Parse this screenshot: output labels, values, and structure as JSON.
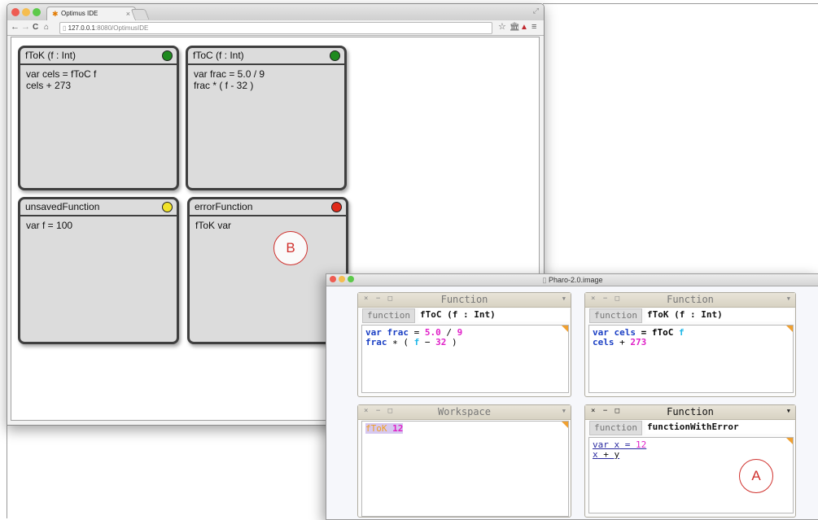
{
  "browser": {
    "tab_title": "Optimus IDE",
    "url_host": "127.0.0.1",
    "url_path": ":8080/OptimusIDE",
    "icons": {
      "back": "left-arrow",
      "forward": "right-arrow",
      "reload": "reload",
      "home": "home",
      "star": "star",
      "close": "×"
    }
  },
  "cards": [
    {
      "name": "fToK (f : Int)",
      "status": "saved",
      "status_color": "#1f8a1f",
      "lines": [
        "var cels = fToC f",
        "cels + 273"
      ]
    },
    {
      "name": "fToC (f : Int)",
      "status": "saved",
      "status_color": "#1f8a1f",
      "lines": [
        "var frac = 5.0 / 9",
        "frac * ( f - 32 )"
      ]
    },
    {
      "name": "unsavedFunction",
      "status": "unsaved",
      "status_color": "#f2e32a",
      "lines": [
        "var f = 100"
      ]
    },
    {
      "name": "errorFunction",
      "status": "error",
      "status_color": "#e02a1a",
      "lines": [
        "fToK var"
      ]
    }
  ],
  "markers": {
    "a": "A",
    "b": "B"
  },
  "pharo": {
    "window_title": "Pharo-2.0.image",
    "windows": [
      {
        "title": "Function",
        "label": "function",
        "signature": "fToC (f : Int)"
      },
      {
        "title": "Function",
        "label": "function",
        "signature": "fToK (f : Int)"
      },
      {
        "title": "Workspace"
      },
      {
        "title": "Function",
        "label": "function",
        "signature": "functionWithError"
      }
    ],
    "code": {
      "w1_l1": [
        "var ",
        "frac",
        " = ",
        "5.0",
        " / ",
        "9"
      ],
      "w1_l2": [
        "frac",
        " ∗ ( ",
        "f",
        " − ",
        "32",
        " )"
      ],
      "w2_l1": [
        "var ",
        "cels",
        " = fToC ",
        "f"
      ],
      "w2_l2": [
        "cels",
        " + ",
        "273"
      ],
      "w3_l1": [
        "fToK",
        " ",
        "12"
      ],
      "w4_l1": [
        "var ",
        "x",
        " = ",
        "12"
      ],
      "w4_l2": [
        "x",
        " + ",
        "y"
      ]
    },
    "colors": {
      "keyword": "#1a3fc4",
      "number": "#e020c8",
      "var": "#22b8e8",
      "call": "#f0a020",
      "error": "#2a2aa0"
    }
  }
}
